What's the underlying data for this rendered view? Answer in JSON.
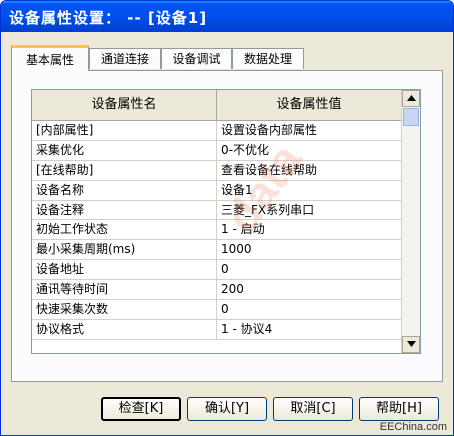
{
  "window": {
    "title": "设备属性设置：  -- [设备1]"
  },
  "tabs": [
    {
      "label": "基本属性",
      "active": true
    },
    {
      "label": "通道连接",
      "active": false
    },
    {
      "label": "设备调试",
      "active": false
    },
    {
      "label": "数据处理",
      "active": false
    }
  ],
  "grid": {
    "headers": {
      "name": "设备属性名",
      "value": "设备属性值"
    },
    "rows": [
      {
        "name": "[内部属性]",
        "value": "设置设备内部属性"
      },
      {
        "name": "采集优化",
        "value": "0-不优化"
      },
      {
        "name": "[在线帮助]",
        "value": "查看设备在线帮助"
      },
      {
        "name": "设备名称",
        "value": "设备1"
      },
      {
        "name": "设备注释",
        "value": "三菱_FX系列串口"
      },
      {
        "name": "初始工作状态",
        "value": "1 - 启动"
      },
      {
        "name": "最小采集周期(ms)",
        "value": "1000"
      },
      {
        "name": "设备地址",
        "value": "0"
      },
      {
        "name": "通讯等待时间",
        "value": "200"
      },
      {
        "name": "快速采集次数",
        "value": "0"
      },
      {
        "name": "协议格式",
        "value": "1 - 协议4"
      }
    ]
  },
  "buttons": {
    "check": "检查[K]",
    "confirm": "确认[Y]",
    "cancel": "取消[C]",
    "help": "帮助[H]"
  },
  "watermark": "data",
  "brand": "EEChina.com",
  "icons": {
    "scroll_up": "triangle-up",
    "scroll_down": "triangle-down"
  }
}
